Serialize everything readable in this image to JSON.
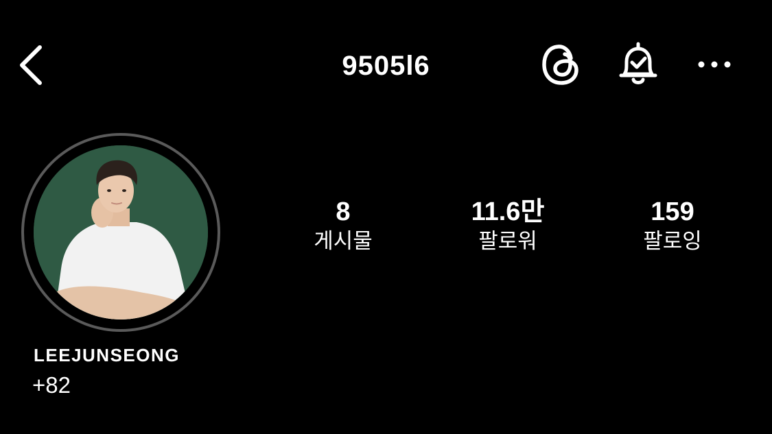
{
  "header": {
    "username": "9505l6",
    "icons": {
      "back": "chevron-left-icon",
      "threads": "threads-icon",
      "notifications": "bell-check-icon",
      "more": "more-horizontal-icon"
    }
  },
  "profile": {
    "avatar": "profile-photo",
    "display_name": "LEEJUNSEONG",
    "bio": "+82"
  },
  "stats": {
    "posts": {
      "count": "8",
      "label": "게시물"
    },
    "followers": {
      "count": "11.6만",
      "label": "팔로워"
    },
    "following": {
      "count": "159",
      "label": "팔로잉"
    }
  },
  "colors": {
    "background": "#000000",
    "text": "#ffffff",
    "avatar_ring": "#5a5a5a",
    "avatar_bg": "#2f5a44"
  }
}
